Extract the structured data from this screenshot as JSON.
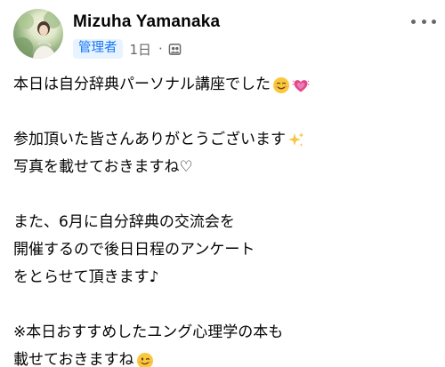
{
  "post": {
    "author": "Mizuha Yamanaka",
    "badge": "管理者",
    "time": "1日",
    "separator": "·",
    "audience_icon": "group-audience-icon",
    "more_icon": "more-options-icon"
  },
  "body": {
    "lines": [
      "本日は自分辞典パーソナル講座でした",
      "",
      "参加頂いた皆さんありがとうございます",
      "写真を載せておきますね♡",
      "",
      "また、6月に自分辞典の交流会を",
      "開催するので後日日程のアンケート",
      "をとらせて頂きます♪",
      "",
      "※本日おすすめしたユング心理学の本も",
      "載せておきますね"
    ],
    "emojis": {
      "line1": [
        "smiling-face-icon",
        "growing-heart-icon"
      ],
      "line3": [
        "sparkles-icon"
      ],
      "line11": [
        "winking-face-icon"
      ]
    }
  },
  "colors": {
    "text": "#050505",
    "secondary": "#65676b",
    "badge_bg": "#e7f3ff",
    "badge_text": "#1877f2",
    "heart": "#e0488b",
    "sparkle": "#f4c542",
    "face": "#f9c93c"
  }
}
